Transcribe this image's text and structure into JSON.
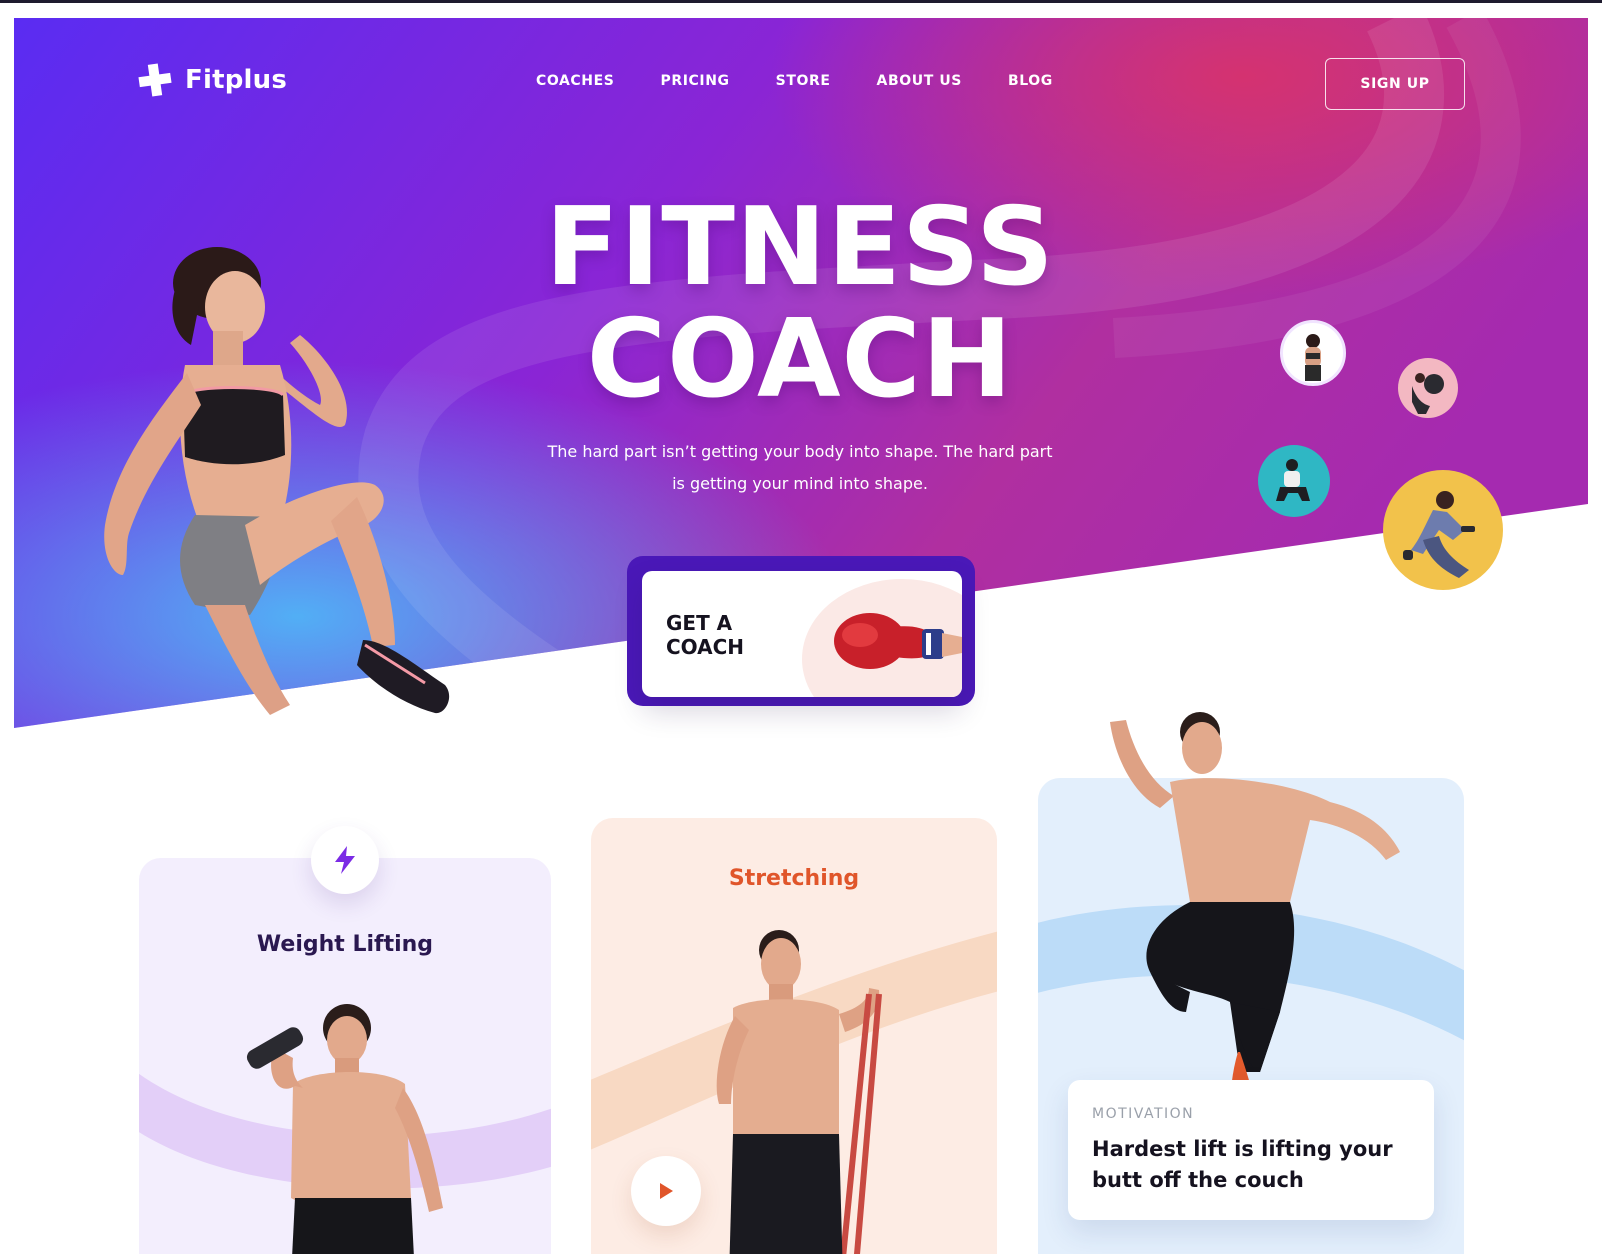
{
  "brand": {
    "name": "Fitplus"
  },
  "nav": {
    "links": [
      "COACHES",
      "PRICING",
      "STORE",
      "ABOUT US",
      "BLOG"
    ],
    "signup_label": "SIGN UP"
  },
  "hero": {
    "title_line1": "FITNESS",
    "title_line2": "COACH",
    "subtitle": "The hard part isn’t getting your body into shape. The hard part is getting your mind into shape.",
    "cta_label": "GET A COACH"
  },
  "cards": {
    "weight_lifting": {
      "title": "Weight Lifting",
      "icon": "lightning-bolt-icon"
    },
    "stretching": {
      "title": "Stretching",
      "icon": "play-icon"
    },
    "motivation": {
      "eyebrow": "MOTIVATION",
      "quote": "Hardest lift is lifting your butt off the couch"
    }
  },
  "colors": {
    "hero_gradient": [
      "#5b2bf0",
      "#8a24d2",
      "#c4306e"
    ],
    "accent_purple": "#7b2be5",
    "accent_orange": "#e0552a",
    "weight_card_bg": "#f3eefd",
    "stretch_card_bg": "#fdece4",
    "motivation_card_bg": "#e3effc"
  }
}
